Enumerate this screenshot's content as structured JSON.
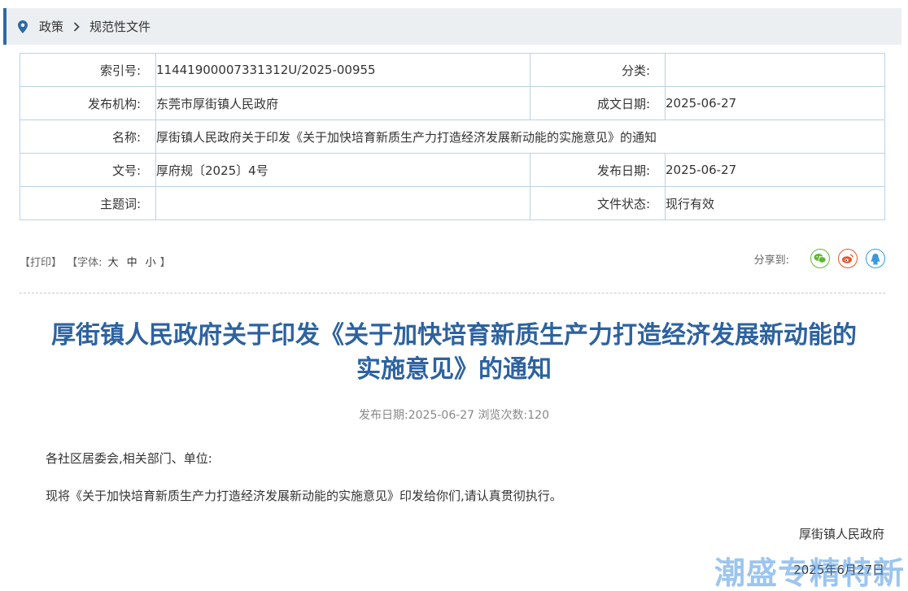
{
  "breadcrumb": {
    "item1": "政策",
    "item2": "规范性文件"
  },
  "meta": {
    "index_label": "索引号:",
    "index_value": "11441900007331312U/2025-00955",
    "category_label": "分类:",
    "category_value": "",
    "issuer_label": "发布机构:",
    "issuer_value": "东莞市厚街镇人民政府",
    "date_made_label": "成文日期:",
    "date_made_value": "2025-06-27",
    "name_label": "名称:",
    "name_value": "厚街镇人民政府关于印发《关于加快培育新质生产力打造经济发展新动能的实施意见》的通知",
    "doc_no_label": "文号:",
    "doc_no_value": "厚府规〔2025〕4号",
    "pub_date_label": "发布日期:",
    "pub_date_value": "2025-06-27",
    "keywords_label": "主题词:",
    "keywords_value": "",
    "status_label": "文件状态:",
    "status_value": "现行有效"
  },
  "tools": {
    "print": "【打印】",
    "font_prefix": "【字体:",
    "font_large": "大",
    "font_medium": "中",
    "font_small": "小",
    "font_suffix": "】",
    "share_label": "分享到:"
  },
  "share_icons": [
    "wechat-icon",
    "weibo-icon",
    "qq-icon"
  ],
  "colors": {
    "accent": "#2d62a0",
    "wechat": "#5fb833",
    "weibo": "#e6562b",
    "qq": "#3a9ad9"
  },
  "article": {
    "title_line1": "厚街镇人民政府关于印发《关于加快培育新质生产力打造经济发展新动能的",
    "title_line2": "实施意见》的通知",
    "pub_info": "发布日期:2025-06-27 浏览次数:120",
    "salutation": "各社区居委会,相关部门、单位:",
    "body": "现将《关于加快培育新质生产力打造经济发展新动能的实施意见》印发给你们,请认真贯彻执行。",
    "signer": "厚街镇人民政府",
    "sign_date": "2025年6月27日"
  },
  "watermark": "潮盛专精特新"
}
